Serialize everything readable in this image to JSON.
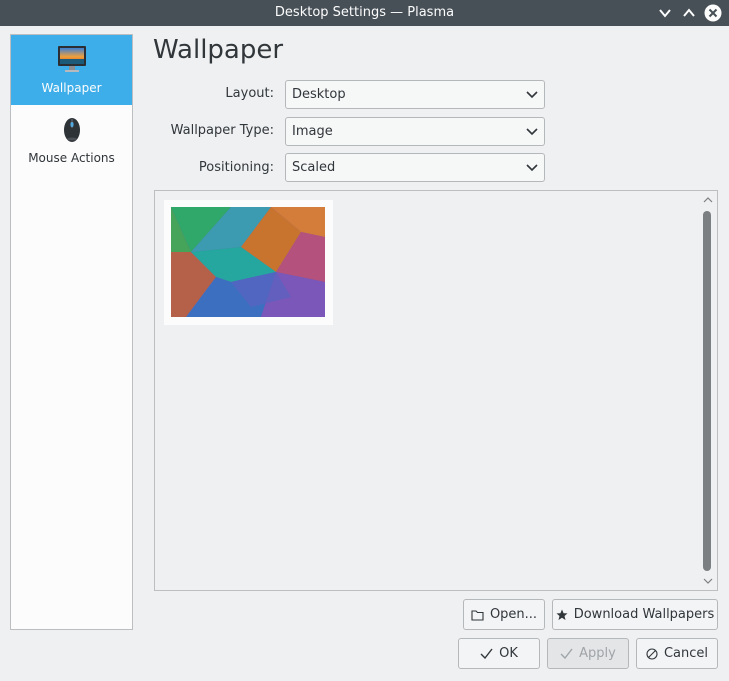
{
  "window": {
    "title": "Desktop Settings — Plasma",
    "controls": [
      "chevron-down-icon",
      "chevron-up-icon",
      "close-icon"
    ]
  },
  "sidebar": {
    "items": [
      {
        "label": "Wallpaper",
        "icon": "monitor-wallpaper-icon",
        "selected": true
      },
      {
        "label": "Mouse Actions",
        "icon": "mouse-icon",
        "selected": false
      }
    ]
  },
  "page": {
    "title": "Wallpaper"
  },
  "form": {
    "layout": {
      "label": "Layout:",
      "value": "Desktop"
    },
    "wallpaper_type": {
      "label": "Wallpaper Type:",
      "value": "Image"
    },
    "positioning": {
      "label": "Positioning:",
      "value": "Scaled"
    }
  },
  "buttons": {
    "open": "Open...",
    "download": "Download Wallpapers",
    "ok": "OK",
    "apply": "Apply",
    "cancel": "Cancel"
  },
  "colors": {
    "accent": "#3daee9",
    "titlebar": "#475057",
    "background": "#eff0f1"
  }
}
